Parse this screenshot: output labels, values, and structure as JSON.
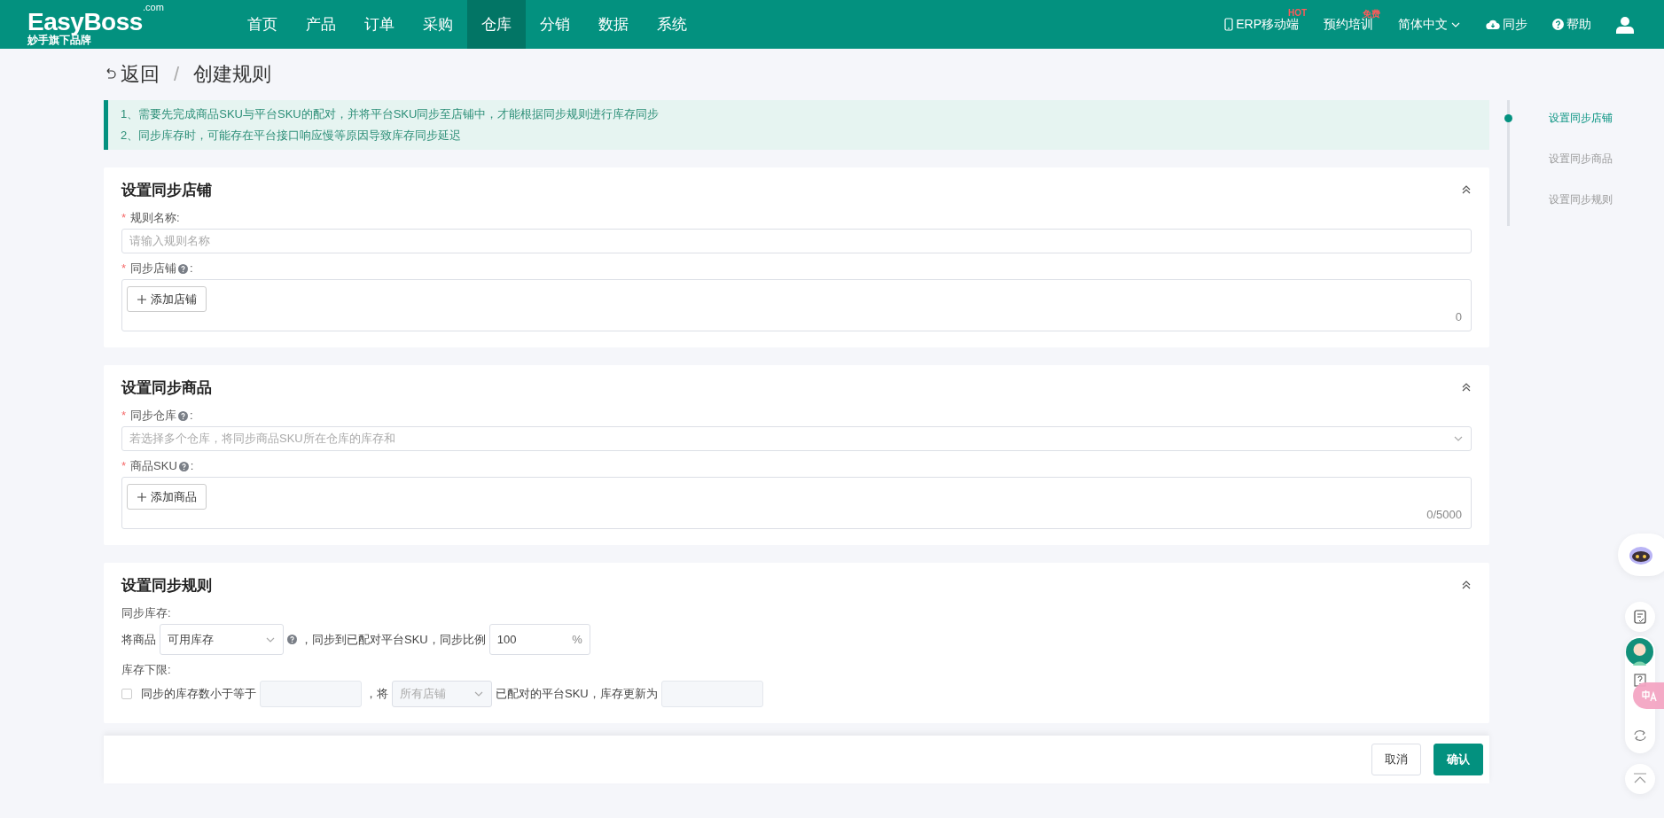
{
  "header": {
    "logo": "EasyBoss",
    "logo_suffix": ".com",
    "logo_sub": "妙手旗下品牌",
    "nav": [
      {
        "label": "首页",
        "selected": false
      },
      {
        "label": "产品",
        "selected": false
      },
      {
        "label": "订单",
        "selected": false
      },
      {
        "label": "采购",
        "selected": false
      },
      {
        "label": "仓库",
        "selected": true
      },
      {
        "label": "分销",
        "selected": false
      },
      {
        "label": "数据",
        "selected": false
      },
      {
        "label": "系统",
        "selected": false
      }
    ],
    "tools": [
      {
        "kind": "mobile",
        "label": "ERP移动端",
        "badge": "HOT"
      },
      {
        "kind": "plain",
        "label": "预约培训",
        "badge": "免费"
      },
      {
        "kind": "language",
        "label": "简体中文"
      },
      {
        "kind": "sync",
        "label": "同步"
      },
      {
        "kind": "help",
        "label": "帮助"
      },
      {
        "kind": "user"
      }
    ]
  },
  "breadcrumb": {
    "back": "返回",
    "separator": "/",
    "current": "创建规则"
  },
  "required_mark": "*",
  "notice": [
    "1、需要先完成商品SKU与平台SKU的配对，并将平台SKU同步至店铺中，才能根据同步规则进行库存同步",
    "2、同步库存时，可能存在平台接口响应慢等原因导致库存同步延迟"
  ],
  "sections": [
    {
      "title": "设置同步店铺",
      "expanded": true,
      "fields": [
        {
          "kind": "input",
          "required": true,
          "label": "规则名称:",
          "placeholder": "请输入规则名称"
        },
        {
          "kind": "picker",
          "required": true,
          "label": "同步店铺",
          "help": true,
          "suffix": ":",
          "button": "添加店铺",
          "count": "0"
        }
      ]
    },
    {
      "title": "设置同步商品",
      "expanded": true,
      "fields": [
        {
          "kind": "select",
          "required": true,
          "label": "同步仓库",
          "help": true,
          "suffix": ":",
          "placeholder": "若选择多个仓库，将同步商品SKU所在仓库的库存和"
        },
        {
          "kind": "picker",
          "required": true,
          "label": "商品SKU",
          "help": true,
          "suffix": ":",
          "button": "添加商品",
          "count": "0/5000"
        }
      ]
    },
    {
      "title": "设置同步规则",
      "expanded": true,
      "fields": [
        {
          "kind": "stock_rule",
          "required": false,
          "label": "同步库存:",
          "prefix": "将商品",
          "select": "可用库存",
          "help": true,
          "text": "，同步到已配对平台SKU，同步比例",
          "ratio": "100",
          "unit": "%"
        },
        {
          "kind": "floor_rule",
          "required": false,
          "label": "库存下限:",
          "checked": false,
          "text1": "同步的库存数小于等于",
          "text2": "，将",
          "select_placeholder": "所有店铺",
          "text3": "已配对的平台SKU，库存更新为"
        }
      ]
    }
  ],
  "anchors": [
    {
      "label": "设置同步店铺",
      "selected": true
    },
    {
      "label": "设置同步商品",
      "selected": false
    },
    {
      "label": "设置同步规则",
      "selected": false
    }
  ],
  "footer": [
    {
      "label": "取消",
      "kind": "secondary"
    },
    {
      "label": "确认",
      "kind": "primary"
    }
  ]
}
